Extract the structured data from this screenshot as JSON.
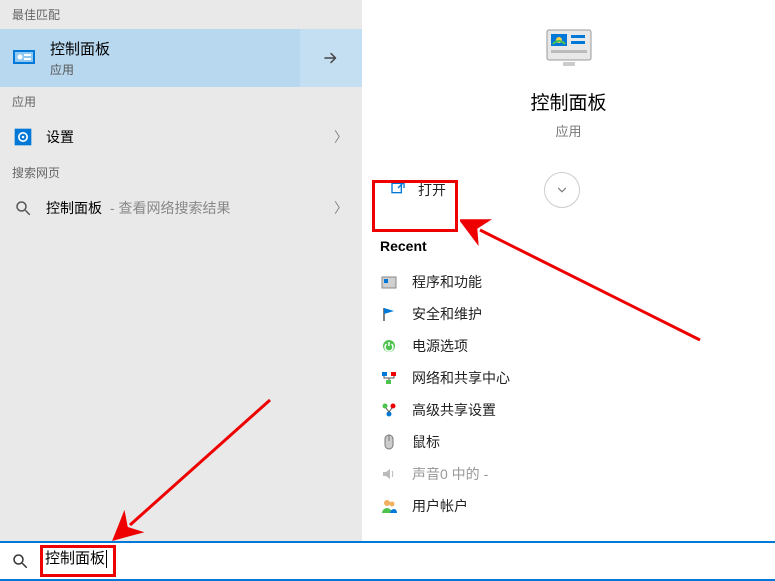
{
  "left": {
    "sections": {
      "best_match": "最佳匹配",
      "apps": "应用",
      "web": "搜索网页"
    },
    "best_match_item": {
      "title": "控制面板",
      "subtitle": "应用"
    },
    "apps_item": {
      "label": "设置"
    },
    "web_item": {
      "label": "控制面板",
      "suffix": " - 查看网络搜索结果"
    }
  },
  "right": {
    "title": "控制面板",
    "subtitle": "应用",
    "open_label": "打开",
    "recent_header": "Recent",
    "recent": [
      {
        "label": "程序和功能"
      },
      {
        "label": "安全和维护"
      },
      {
        "label": "电源选项"
      },
      {
        "label": "网络和共享中心"
      },
      {
        "label": "高级共享设置"
      },
      {
        "label": "鼠标"
      },
      {
        "label": "声音0 中的 -",
        "dim": true
      },
      {
        "label": "用户帐户"
      }
    ]
  },
  "search": {
    "value": "控制面板"
  }
}
